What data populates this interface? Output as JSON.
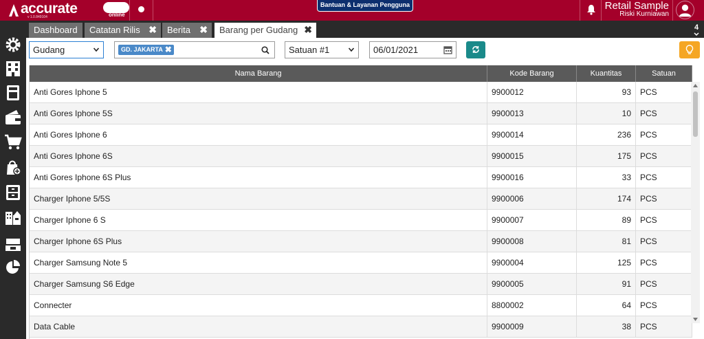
{
  "app": {
    "logo_text": "accurate",
    "logo_sub": "online",
    "version": "v 1.0.849104",
    "help_button": "Bantuan & Layanan Pengguna",
    "user_company": "Retail Sample",
    "user_name": "Riski Kurniawan"
  },
  "tabs": [
    {
      "label": "Dashboard",
      "closable": false
    },
    {
      "label": "Catatan Rilis",
      "closable": true
    },
    {
      "label": "Berita",
      "closable": true
    },
    {
      "label": "Barang per Gudang",
      "closable": true,
      "active": true
    }
  ],
  "tab_count": "4",
  "filters": {
    "type_select": "Gudang",
    "warehouse_tag": "GD. JAKARTA",
    "unit_select": "Satuan #1",
    "date": "06/01/2021"
  },
  "table": {
    "headers": [
      "Nama Barang",
      "Kode Barang",
      "Kuantitas",
      "Satuan"
    ],
    "rows": [
      {
        "name": "Anti Gores Iphone 5",
        "code": "9900012",
        "qty": "93",
        "unit": "PCS"
      },
      {
        "name": "Anti Gores Iphone 5S",
        "code": "9900013",
        "qty": "10",
        "unit": "PCS"
      },
      {
        "name": "Anti Gores Iphone 6",
        "code": "9900014",
        "qty": "236",
        "unit": "PCS"
      },
      {
        "name": "Anti Gores Iphone 6S",
        "code": "9900015",
        "qty": "175",
        "unit": "PCS"
      },
      {
        "name": "Anti Gores Iphone 6S Plus",
        "code": "9900016",
        "qty": "33",
        "unit": "PCS"
      },
      {
        "name": "Charger Iphone 5/5S",
        "code": "9900006",
        "qty": "174",
        "unit": "PCS"
      },
      {
        "name": "Charger Iphone 6 S",
        "code": "9900007",
        "qty": "89",
        "unit": "PCS"
      },
      {
        "name": "Charger Iphone 6S Plus",
        "code": "9900008",
        "qty": "81",
        "unit": "PCS"
      },
      {
        "name": "Charger Samsung Note 5",
        "code": "9900004",
        "qty": "125",
        "unit": "PCS"
      },
      {
        "name": "Charger Samsung S6 Edge",
        "code": "9900005",
        "qty": "91",
        "unit": "PCS"
      },
      {
        "name": "Connecter",
        "code": "8800002",
        "qty": "64",
        "unit": "PCS"
      },
      {
        "name": "Data Cable",
        "code": "9900009",
        "qty": "38",
        "unit": "PCS"
      }
    ]
  },
  "colors": {
    "brand": "#a4002a",
    "sidebar": "#2a2a2a",
    "header": "#5a5a5a",
    "refresh": "#1a8a8a",
    "tip": "#f5a623",
    "tag": "#4a89c8"
  },
  "icons": {
    "sidebar": [
      "gear-icon",
      "building-icon",
      "calculator-icon",
      "wallet-icon",
      "cart-icon",
      "bag-add-icon",
      "cabinet-icon",
      "city-icon",
      "cash-icon",
      "pie-chart-icon"
    ]
  }
}
